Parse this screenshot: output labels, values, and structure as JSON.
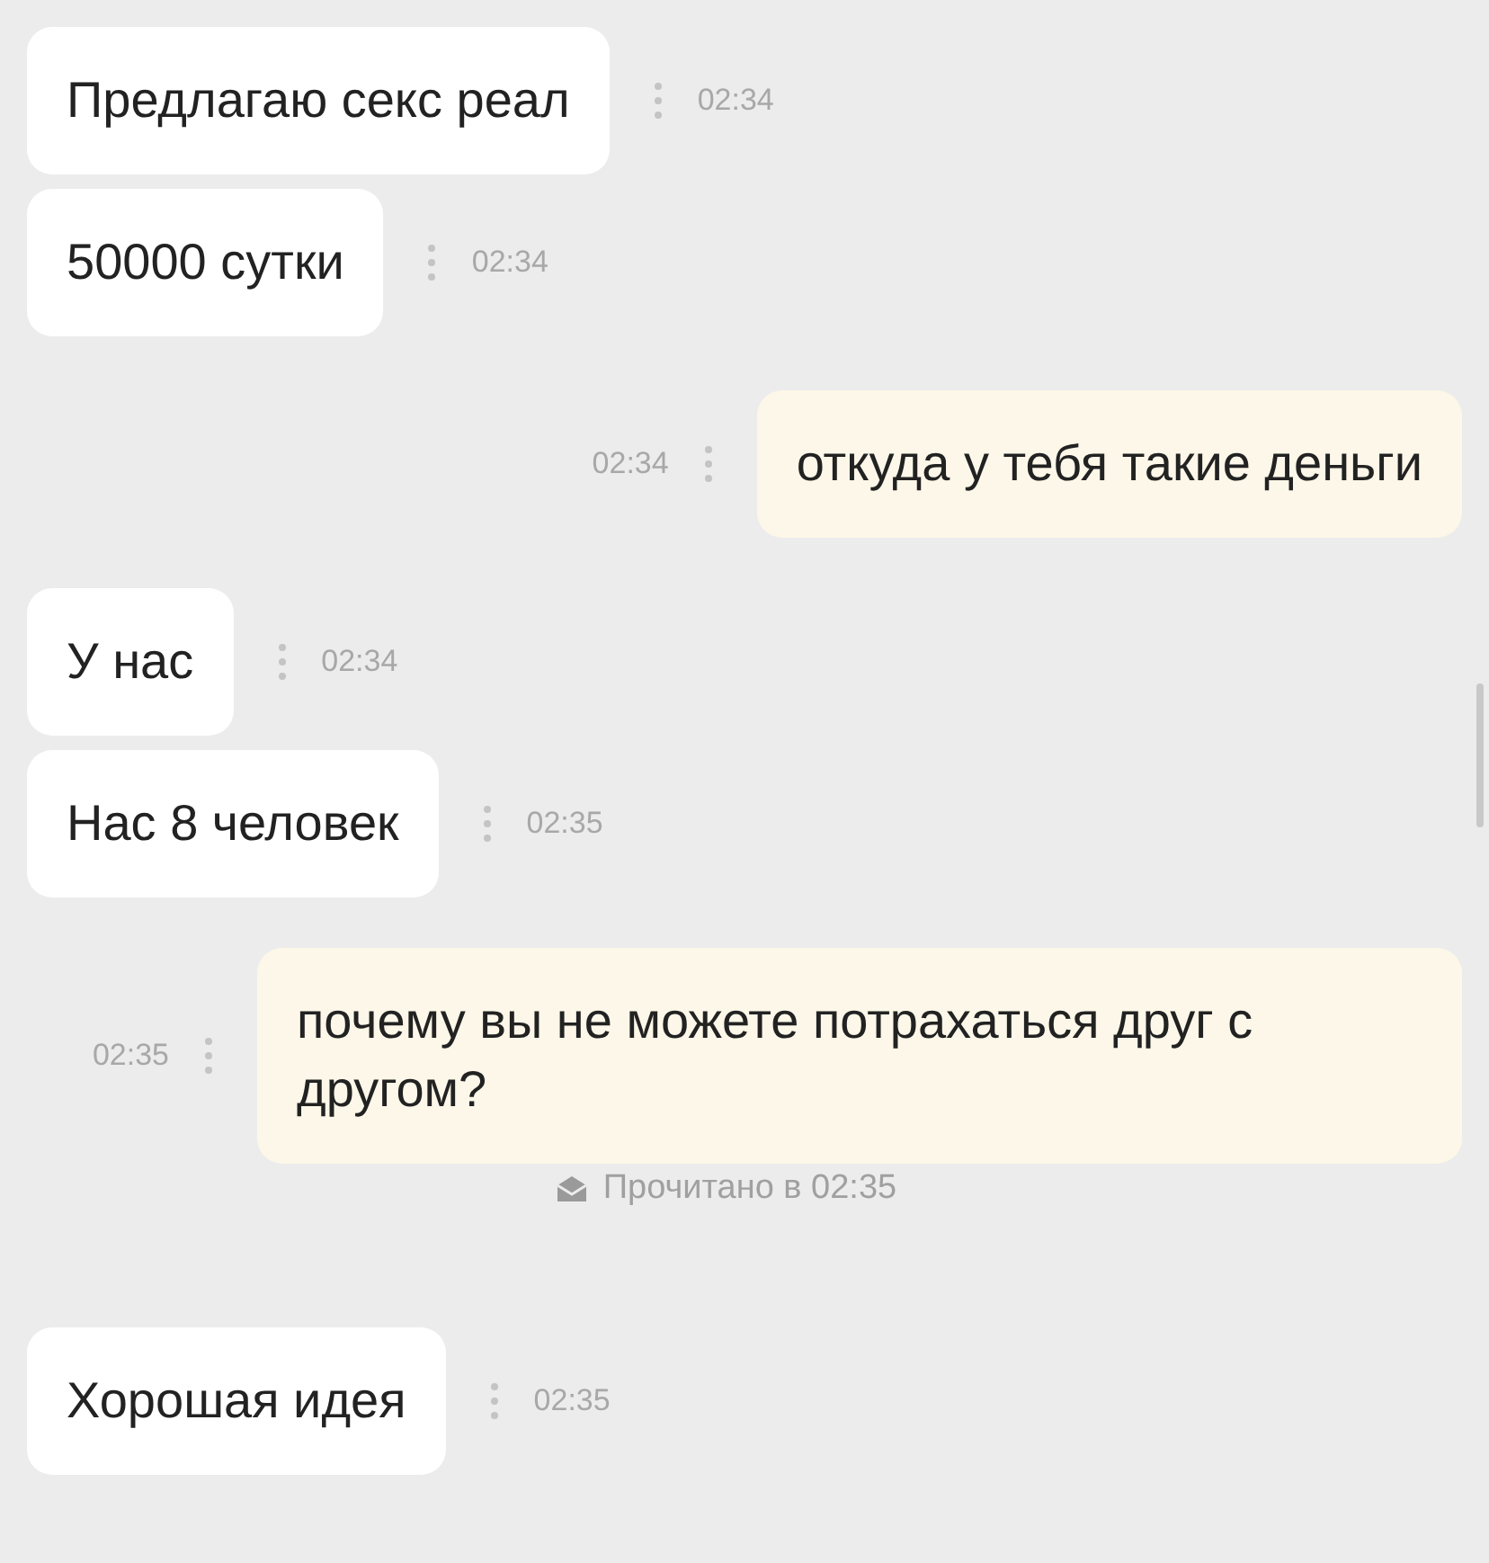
{
  "messages": [
    {
      "kind": "incoming",
      "text": "Предлагаю секс реал",
      "time": "02:34"
    },
    {
      "kind": "incoming",
      "text": "50000 сутки",
      "time": "02:34"
    },
    {
      "kind": "outgoing",
      "text": "откуда у тебя такие деньги",
      "time": "02:34"
    },
    {
      "kind": "incoming",
      "text": "У нас",
      "time": "02:34"
    },
    {
      "kind": "incoming",
      "text": "Нас 8 человек",
      "time": "02:35"
    },
    {
      "kind": "outgoing",
      "text": "почему вы не можете потрахаться друг с другом?",
      "time": "02:35"
    },
    {
      "kind": "receipt",
      "text": "Прочитано в 02:35"
    },
    {
      "kind": "incoming",
      "text": "Хорошая идея",
      "time": "02:35"
    }
  ]
}
